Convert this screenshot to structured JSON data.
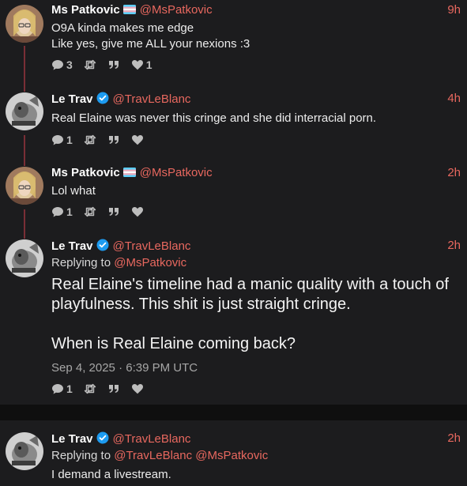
{
  "tweets": [
    {
      "name": "Ms Patkovic",
      "handle": "@MsPatkovic",
      "time": "9h",
      "line1": "O9A kinda makes me edge",
      "line2": "Like yes, give me ALL your nexions :3",
      "replies": "3",
      "likes": "1"
    },
    {
      "name": "Le Trav",
      "handle": "@TravLeBlanc",
      "time": "4h",
      "text": "Real Elaine was never this cringe and she did interracial porn.",
      "replies": "1"
    },
    {
      "name": "Ms Patkovic",
      "handle": "@MsPatkovic",
      "time": "2h",
      "text": "Lol what",
      "replies": "1"
    },
    {
      "name": "Le Trav",
      "handle": "@TravLeBlanc",
      "time": "2h",
      "replying_label": "Replying to",
      "replying_mention": "@MsPatkovic",
      "text_line1": "Real Elaine's timeline had a manic quality with a touch of",
      "text_line2": "playfulness. This shit is just straight cringe.",
      "text_line3": "When is Real Elaine coming back?",
      "date": "Sep 4, 2025 · 6:39 PM UTC",
      "replies": "1"
    },
    {
      "name": "Le Trav",
      "handle": "@TravLeBlanc",
      "time": "2h",
      "replying_label": "Replying to",
      "replying_mention1": "@TravLeBlanc",
      "replying_mention2": "@MsPatkovic",
      "text": "I demand a livestream."
    }
  ],
  "colors": {
    "accent": "#e8685f",
    "thread_line": "#7a2e36",
    "card": "#1c1c1e",
    "verified": "#1d9bf0"
  },
  "icons": [
    "comment-icon",
    "retweet-icon",
    "quote-icon",
    "heart-icon",
    "verified-icon",
    "trans-flag-icon"
  ]
}
